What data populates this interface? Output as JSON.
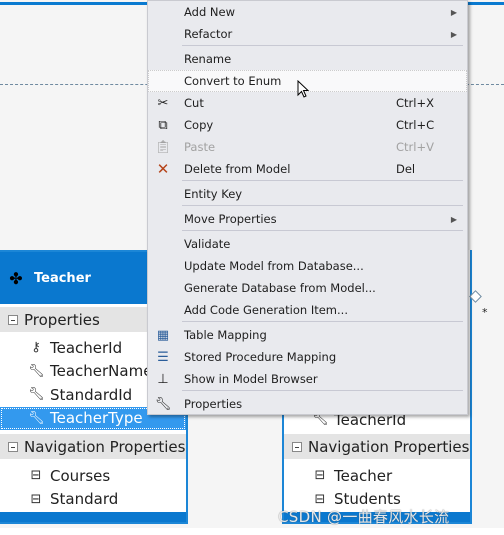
{
  "context_menu": {
    "items": [
      {
        "label": "Add New",
        "icon": "",
        "shortcut": "",
        "submenu": true
      },
      {
        "label": "Refactor",
        "icon": "",
        "shortcut": "",
        "submenu": true
      },
      {
        "label": "Rename",
        "icon": "",
        "shortcut": ""
      },
      {
        "label": "Convert to Enum",
        "icon": "",
        "shortcut": "",
        "highlighted": true
      },
      {
        "label": "Cut",
        "icon": "scissors-icon",
        "shortcut": "Ctrl+X"
      },
      {
        "label": "Copy",
        "icon": "copy-icon",
        "shortcut": "Ctrl+C"
      },
      {
        "label": "Paste",
        "icon": "paste-icon",
        "shortcut": "Ctrl+V",
        "disabled": true
      },
      {
        "label": "Delete from Model",
        "icon": "delete-x-icon",
        "shortcut": "Del"
      },
      {
        "label": "Entity Key",
        "icon": "",
        "shortcut": ""
      },
      {
        "label": "Move Properties",
        "icon": "",
        "shortcut": "",
        "submenu": true
      },
      {
        "label": "Validate",
        "icon": "",
        "shortcut": ""
      },
      {
        "label": "Update Model from Database...",
        "icon": "",
        "shortcut": ""
      },
      {
        "label": "Generate Database from Model...",
        "icon": "",
        "shortcut": ""
      },
      {
        "label": "Add Code Generation Item...",
        "icon": "",
        "shortcut": ""
      },
      {
        "label": "Table Mapping",
        "icon": "table-mapping-icon",
        "shortcut": ""
      },
      {
        "label": "Stored Procedure Mapping",
        "icon": "stored-procedure-icon",
        "shortcut": ""
      },
      {
        "label": "Show in Model Browser",
        "icon": "hierarchy-icon",
        "shortcut": ""
      },
      {
        "label": "Properties",
        "icon": "wrench-icon",
        "shortcut": ""
      }
    ]
  },
  "teacher_entity": {
    "title": "Teacher",
    "properties_label": "Properties",
    "properties": [
      "TeacherId",
      "TeacherName",
      "StandardId",
      "TeacherType"
    ],
    "selected": "TeacherType",
    "nav_label": "Navigation Properties",
    "nav": [
      "Courses",
      "Standard"
    ]
  },
  "right_entity": {
    "partial_property": "TeacherId",
    "nav_label": "Navigation Properties",
    "nav": [
      "Teacher",
      "Students"
    ]
  },
  "association_multiplicity": "*",
  "watermark": "CSDN @一曲春风水长流",
  "colors": {
    "entity_header": "#0a78cf",
    "selection": "#3399ee",
    "menu_bg": "#e9eaee",
    "delete_icon": "#b5441a"
  }
}
